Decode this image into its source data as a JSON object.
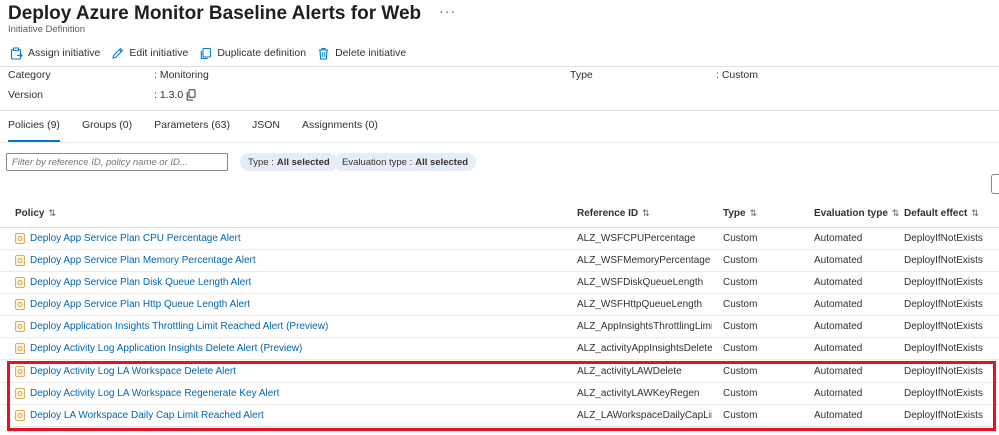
{
  "page": {
    "title": "Deploy Azure Monitor Baseline Alerts for Web",
    "more_label": "···",
    "subtitle": "Initiative Definition"
  },
  "toolbar": {
    "assign_label": "Assign initiative",
    "edit_label": "Edit initiative",
    "duplicate_label": "Duplicate definition",
    "delete_label": "Delete initiative"
  },
  "properties": {
    "category_label": "Category",
    "category_value": ": Monitoring",
    "version_label": "Version",
    "version_value": ": 1.3.0",
    "type_label": "Type",
    "type_value": ": Custom"
  },
  "tabs": [
    {
      "label": "Policies (9)",
      "active": true
    },
    {
      "label": "Groups (0)",
      "active": false
    },
    {
      "label": "Parameters (63)",
      "active": false
    },
    {
      "label": "JSON",
      "active": false
    },
    {
      "label": "Assignments (0)",
      "active": false
    }
  ],
  "filters": {
    "search_placeholder": "Filter by reference ID, policy name or ID...",
    "type_pill_label": "Type :",
    "type_pill_value": "All selected",
    "eval_pill_label": "Evaluation type :",
    "eval_pill_value": "All selected"
  },
  "table": {
    "columns": [
      "Policy",
      "Reference ID",
      "Type",
      "Evaluation type",
      "Default effect"
    ],
    "sort_glyph": "⇅",
    "rows": [
      {
        "policy": "Deploy App Service Plan CPU Percentage Alert",
        "ref": "ALZ_WSFCPUPercentage",
        "type": "Custom",
        "eval": "Automated",
        "effect": "DeployIfNotExists"
      },
      {
        "policy": "Deploy App Service Plan Memory Percentage Alert",
        "ref": "ALZ_WSFMemoryPercentage",
        "type": "Custom",
        "eval": "Automated",
        "effect": "DeployIfNotExists"
      },
      {
        "policy": "Deploy App Service Plan Disk Queue Length Alert",
        "ref": "ALZ_WSFDiskQueueLength",
        "type": "Custom",
        "eval": "Automated",
        "effect": "DeployIfNotExists"
      },
      {
        "policy": "Deploy App Service Plan Http Queue Length Alert",
        "ref": "ALZ_WSFHttpQueueLength",
        "type": "Custom",
        "eval": "Automated",
        "effect": "DeployIfNotExists"
      },
      {
        "policy": "Deploy Application Insights Throttling Limit Reached Alert (Preview)",
        "ref": "ALZ_AppInsightsThrottlingLimi...",
        "type": "Custom",
        "eval": "Automated",
        "effect": "DeployIfNotExists"
      },
      {
        "policy": "Deploy Activity Log Application Insights Delete Alert (Preview)",
        "ref": "ALZ_activityAppInsightsDelete",
        "type": "Custom",
        "eval": "Automated",
        "effect": "DeployIfNotExists"
      },
      {
        "policy": "Deploy Activity Log LA Workspace Delete Alert",
        "ref": "ALZ_activityLAWDelete",
        "type": "Custom",
        "eval": "Automated",
        "effect": "DeployIfNotExists"
      },
      {
        "policy": "Deploy Activity Log LA Workspace Regenerate Key Alert",
        "ref": "ALZ_activityLAWKeyRegen",
        "type": "Custom",
        "eval": "Automated",
        "effect": "DeployIfNotExists"
      },
      {
        "policy": "Deploy LA Workspace Daily Cap Limit Reached Alert",
        "ref": "ALZ_LAWorkspaceDailyCapLimi...",
        "type": "Custom",
        "eval": "Automated",
        "effect": "DeployIfNotExists"
      }
    ]
  },
  "colors": {
    "link": "#0065b3",
    "accent": "#0078d4",
    "highlight": "#e81123",
    "pill_bg": "#e5eef8"
  }
}
